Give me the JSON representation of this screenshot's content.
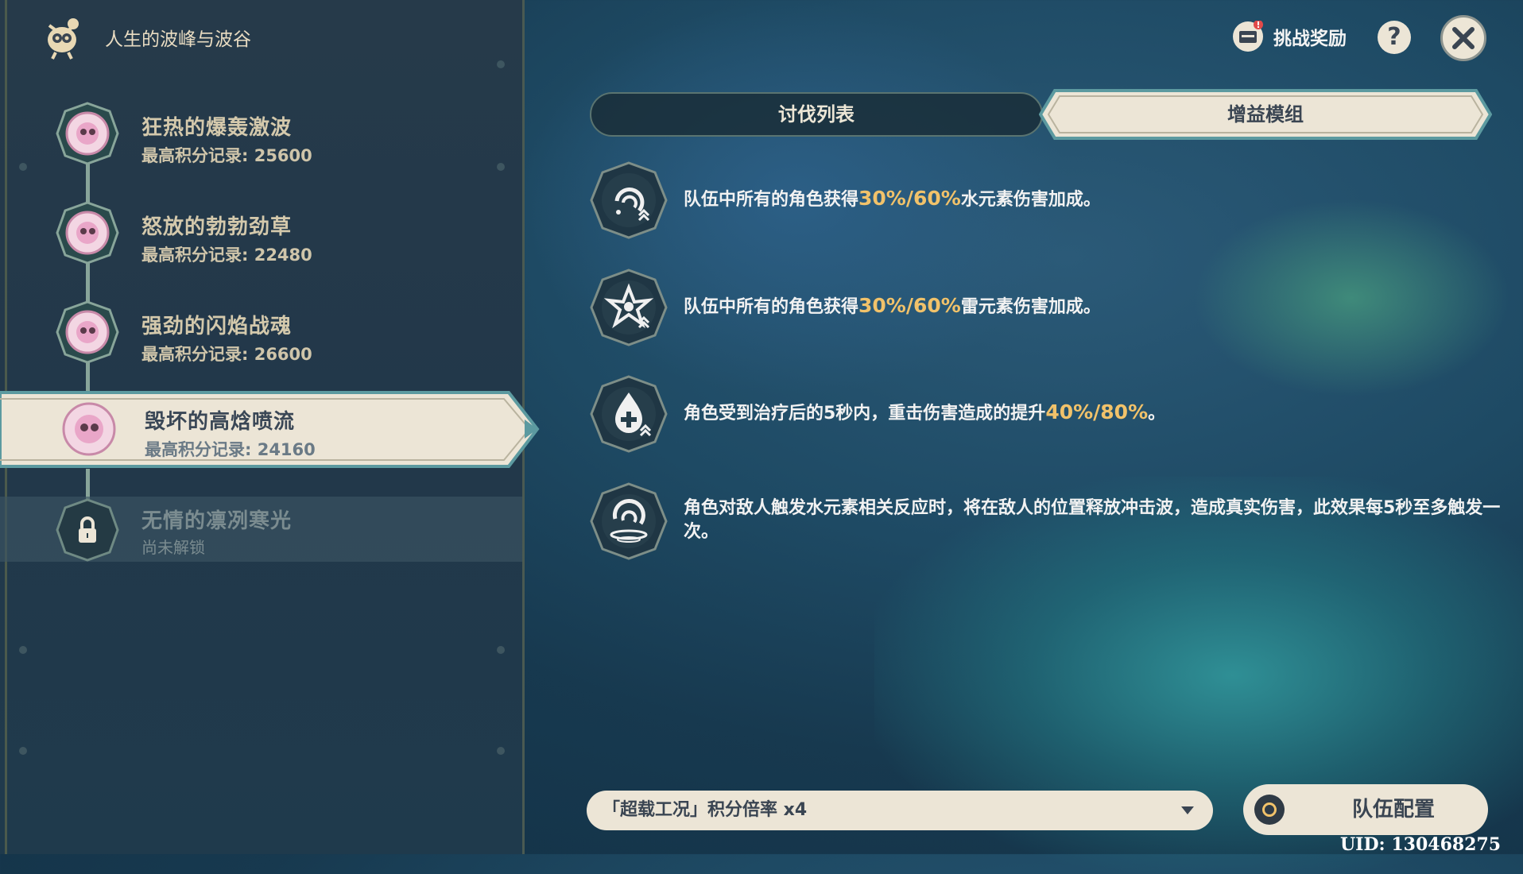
{
  "header": {
    "title": "人生的波峰与波谷"
  },
  "stages": [
    {
      "name": "狂热的爆轰激波",
      "score": "最高积分记录: 25600"
    },
    {
      "name": "怒放的勃勃劲草",
      "score": "最高积分记录: 22480"
    },
    {
      "name": "强劲的闪焰战魂",
      "score": "最高积分记录: 26600"
    },
    {
      "name": "毁坏的高焓喷流",
      "score": "最高积分记录: 24160"
    },
    {
      "name": "无情的凛冽寒光",
      "score": "尚未解锁"
    }
  ],
  "top_bar": {
    "reward_label": "挑战奖励",
    "help_label": "?"
  },
  "tabs": {
    "left": "讨伐列表",
    "right": "增益模组"
  },
  "buffs": [
    {
      "pre": "队伍中所有的角色获得",
      "hl": "30%/60%",
      "post": "水元素伤害加成。"
    },
    {
      "pre": "队伍中所有的角色获得",
      "hl": "30%/60%",
      "post": "雷元素伤害加成。"
    },
    {
      "pre": "角色受到治疗后的5秒内，重击伤害造成的提升",
      "hl": "40%/80%",
      "post": "。"
    },
    {
      "text": "角色对敌人触发水元素相关反应时，将在敌人的位置释放冲击波，造成真实伤害，此效果每5秒至多触发一次。"
    }
  ],
  "bottom": {
    "multiplier_label": "「超载工况」积分倍率 x4",
    "team_label": "队伍配置",
    "uid": "UID: 130468275"
  },
  "colors": {
    "highlight": "#f1c26a",
    "cream": "#ece5d6",
    "dark_text": "#3a4552"
  }
}
